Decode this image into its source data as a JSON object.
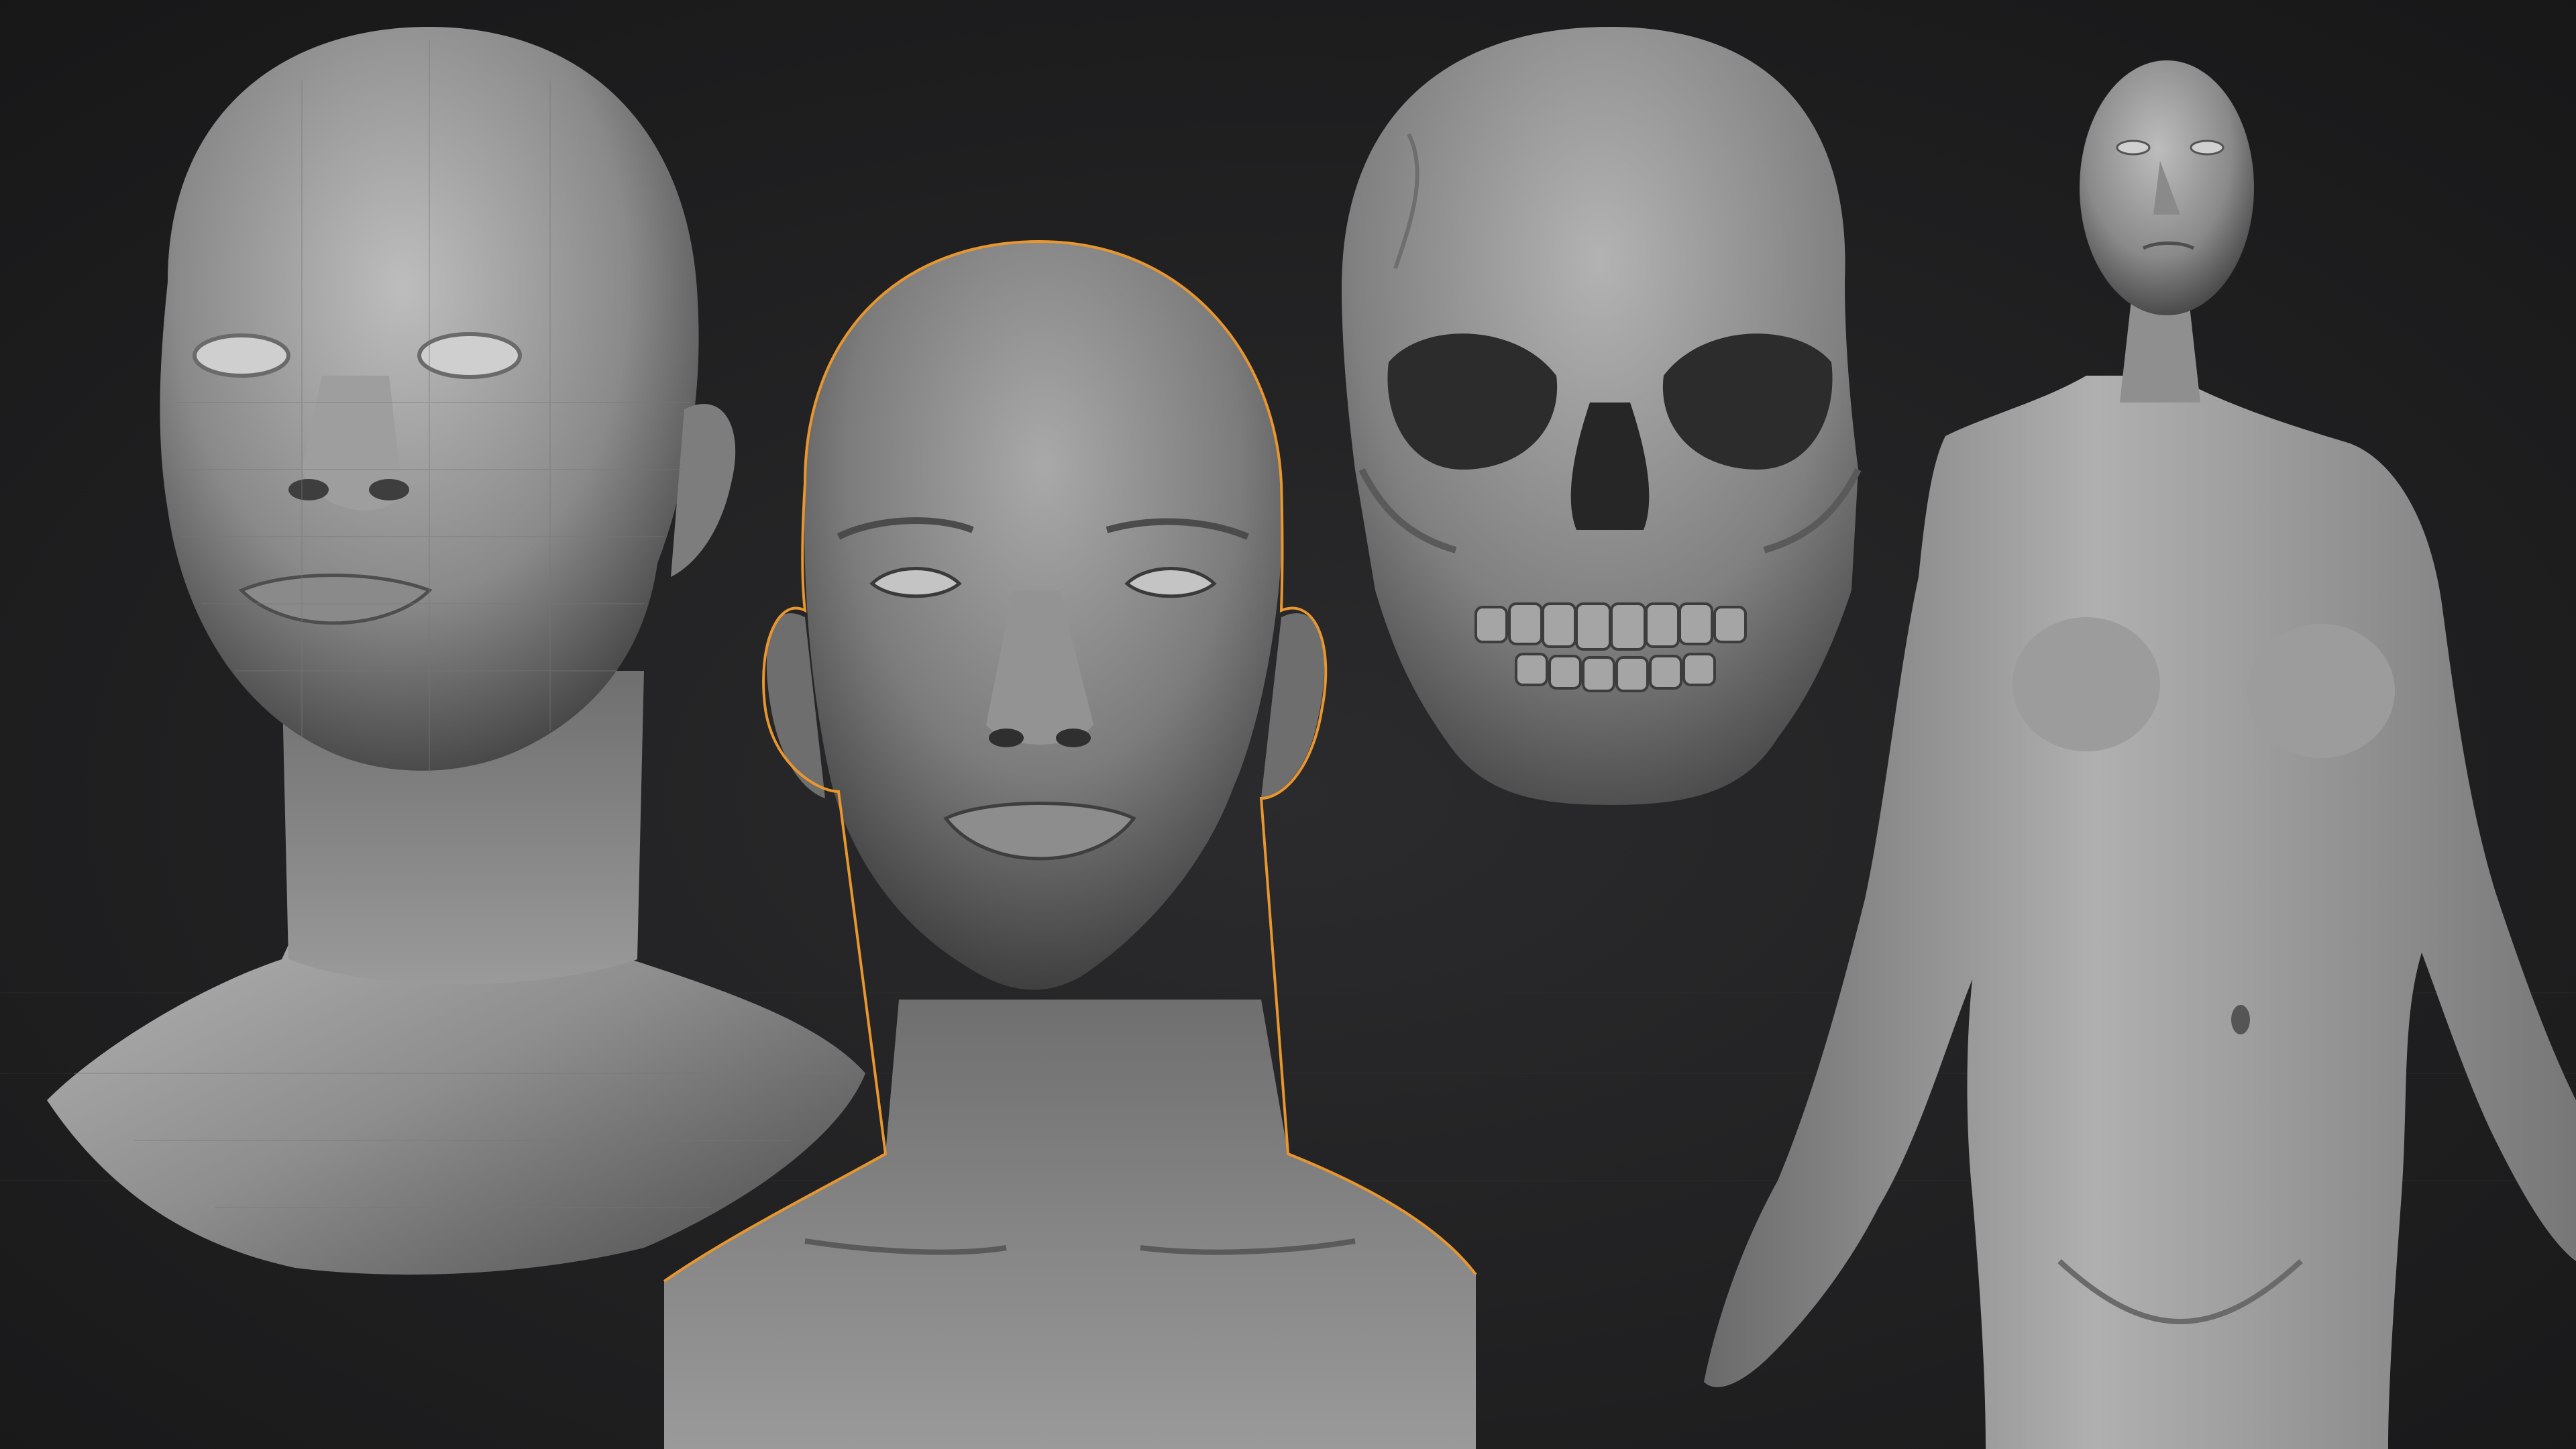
{
  "scene": {
    "background_color": "#1e1e1f",
    "floor_grid_color": "#2a2a2c",
    "selection_outline_color": "#e8962e",
    "models": [
      {
        "name": "low-poly-female-head-bust",
        "selected": false
      },
      {
        "name": "high-detail-female-head-bust",
        "selected": true
      },
      {
        "name": "human-skull",
        "selected": false
      },
      {
        "name": "female-body-figure",
        "selected": false
      }
    ]
  }
}
